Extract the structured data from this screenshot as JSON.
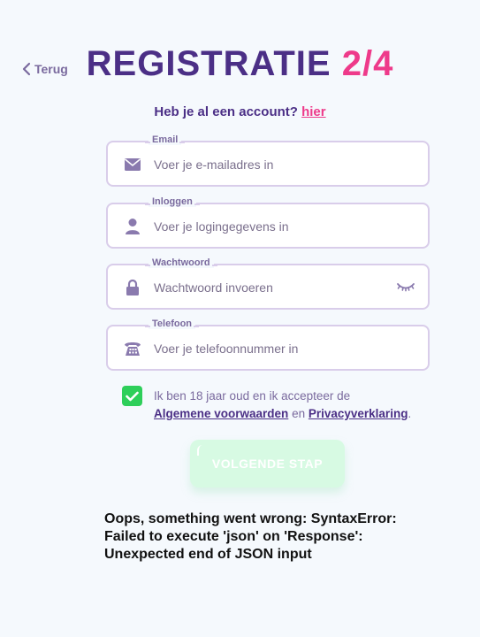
{
  "back": {
    "label": "Terug"
  },
  "title": {
    "main": "REGISTRATIE",
    "step": "2/4"
  },
  "subtitle": {
    "text": "Heb je al een account?",
    "link": "hier"
  },
  "fields": [
    {
      "label": "Email",
      "placeholder": "Voer je e-mailadres in",
      "icon": "envelope-icon"
    },
    {
      "label": "Inloggen",
      "placeholder": "Voer je logingegevens in",
      "icon": "user-icon"
    },
    {
      "label": "Wachtwoord",
      "placeholder": "Wachtwoord invoeren",
      "icon": "lock-icon"
    },
    {
      "label": "Telefoon",
      "placeholder": "Voer je telefoonnummer in",
      "icon": "telephone-icon"
    }
  ],
  "terms": {
    "checked": true,
    "text_before": "Ik ben 18 jaar oud en ik accepteer de",
    "link1": "Algemene voorwaarden",
    "connector": "en",
    "link2": "Privacyverklaring",
    "end": "."
  },
  "next_button": {
    "label": "VOLGENDE STAP"
  },
  "error": {
    "text": "Oops, something went wrong: SyntaxError: Failed to execute 'json' on 'Response': Unexpected end of JSON input"
  },
  "colors": {
    "primary": "#4b2f86",
    "accent": "#ee3a8a",
    "checkbox": "#2ecf5a",
    "button": "#d7fae3",
    "field_border": "#d9cdea"
  }
}
